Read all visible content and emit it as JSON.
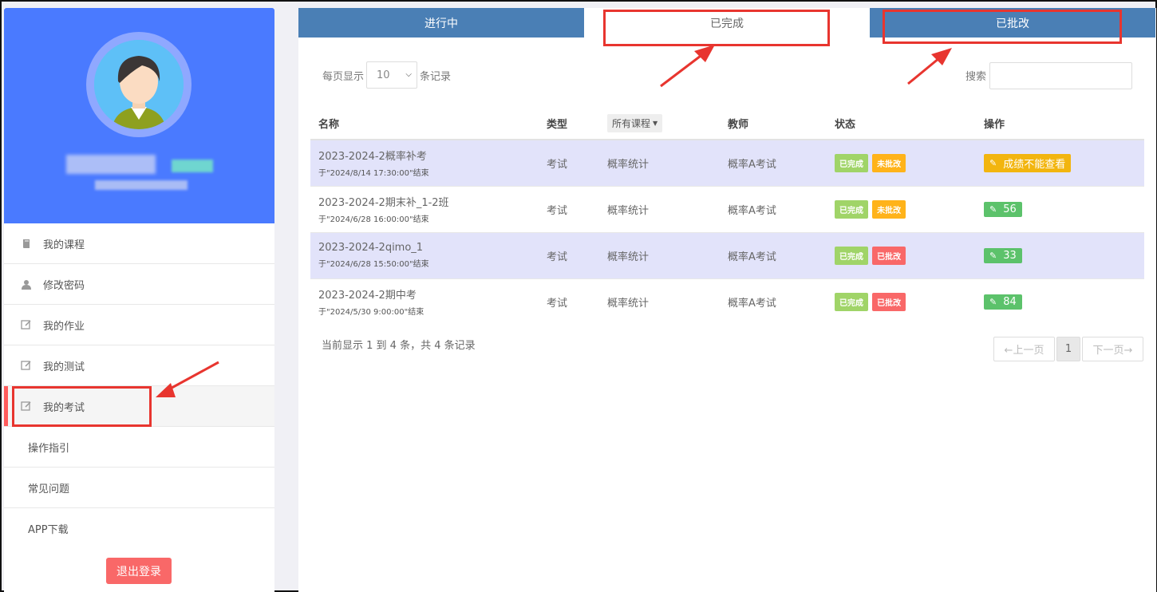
{
  "sidebar": {
    "menu": [
      {
        "label": "我的课程",
        "icon": "book-icon"
      },
      {
        "label": "修改密码",
        "icon": "user-icon"
      },
      {
        "label": "我的作业",
        "icon": "edit-icon"
      },
      {
        "label": "我的测试",
        "icon": "edit-icon"
      },
      {
        "label": "我的考试",
        "icon": "edit-icon"
      },
      {
        "label": "操作指引"
      },
      {
        "label": "常见问题"
      },
      {
        "label": "APP下载"
      }
    ],
    "logout_label": "退出登录"
  },
  "tabs": [
    {
      "label": "进行中"
    },
    {
      "label": "已完成"
    },
    {
      "label": "已批改"
    }
  ],
  "controls": {
    "show_label": "每页显示",
    "page_size": "10",
    "records_label": "条记录",
    "search_label": "搜索"
  },
  "table": {
    "headers": {
      "name": "名称",
      "type": "类型",
      "course_filter": "所有课程",
      "teacher": "教师",
      "status": "状态",
      "action": "操作"
    },
    "rows": [
      {
        "name": "2023-2024-2概率补考",
        "deadline": "于\"2024/8/14 17:30:00\"结束",
        "type": "考试",
        "course": "概率统计",
        "teacher": "概率A考试",
        "status1": "已完成",
        "status2": "未批改",
        "action": "成绩不能查看"
      },
      {
        "name": "2023-2024-2期末补_1-2班",
        "deadline": "于\"2024/6/28 16:00:00\"结束",
        "type": "考试",
        "course": "概率统计",
        "teacher": "概率A考试",
        "status1": "已完成",
        "status2": "未批改",
        "action": "56"
      },
      {
        "name": "2023-2024-2qimo_1",
        "deadline": "于\"2024/6/28 15:50:00\"结束",
        "type": "考试",
        "course": "概率统计",
        "teacher": "概率A考试",
        "status1": "已完成",
        "status2": "已批改",
        "action": "33"
      },
      {
        "name": "2023-2024-2期中考",
        "deadline": "于\"2024/5/30 9:00:00\"结束",
        "type": "考试",
        "course": "概率统计",
        "teacher": "概率A考试",
        "status1": "已完成",
        "status2": "已批改",
        "action": "84"
      }
    ]
  },
  "footer": {
    "summary": "当前显示 1 到 4 条，共 4 条记录",
    "prev": "←上一页",
    "page": "1",
    "next": "下一页→"
  },
  "colors": {
    "profile_bg": "#4a7aff",
    "tab_bg": "#4a7fb5",
    "annotation": "#e8352f"
  }
}
